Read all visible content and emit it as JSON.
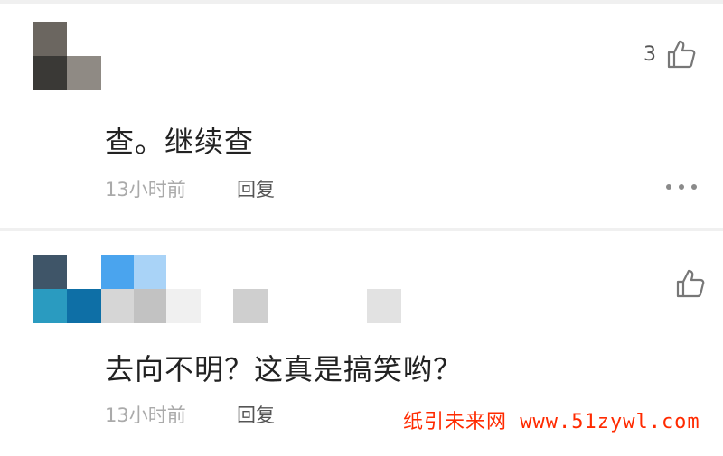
{
  "comments": [
    {
      "avatar_alt": "blurred avatar",
      "like_count": "3",
      "text": "查。继续查",
      "time": "13小时前",
      "reply_label": "回复"
    },
    {
      "avatar_alt": "blurred avatar",
      "like_count": "",
      "text": "去向不明？这真是搞笑哟？",
      "time": "13小时前",
      "reply_label": "回复"
    }
  ],
  "watermark": {
    "text": "纸引未来网 www.51zywl.com"
  },
  "colors": {
    "watermark": "#ff2a00",
    "divider": "#f0f0f0",
    "muted_text": "#aaaaaa"
  },
  "icons": {
    "like": "thumbs-up-icon",
    "more": "more-options-icon"
  }
}
